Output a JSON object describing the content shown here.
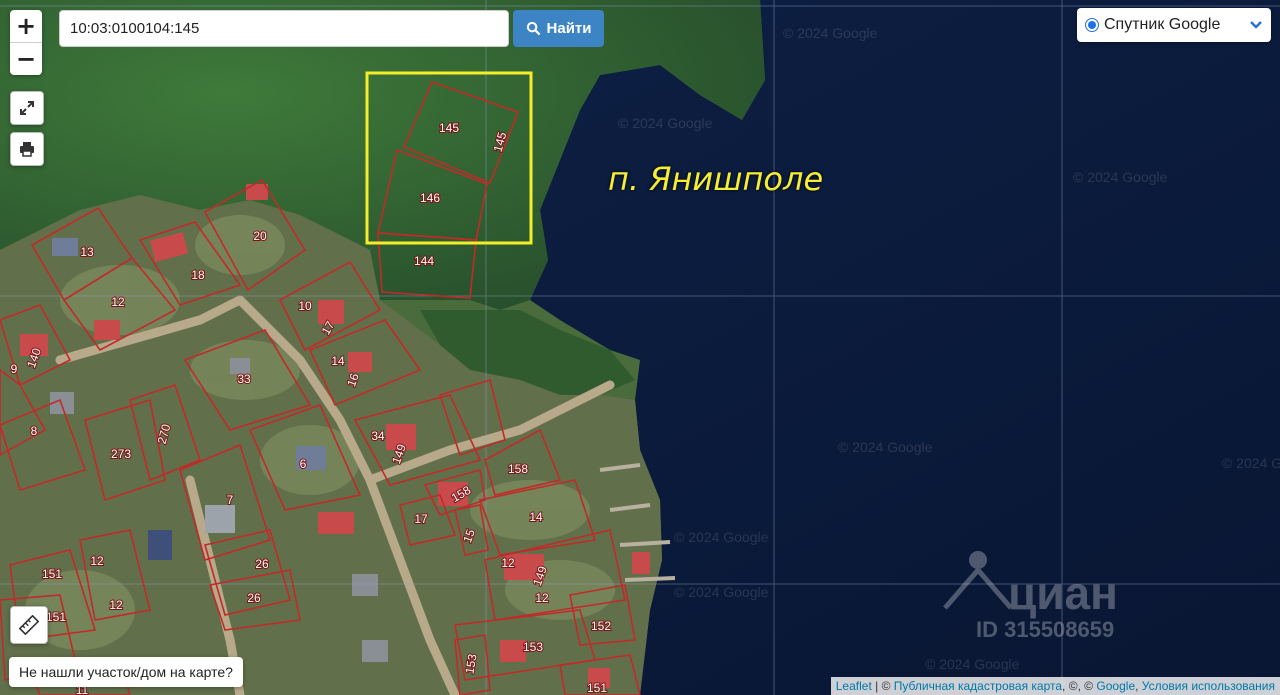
{
  "search": {
    "value": "10:03:0100104:145",
    "button_label": "Найти"
  },
  "zoom": {
    "in_label": "+",
    "out_label": "−"
  },
  "layer_select": {
    "selected": "Спутник Google"
  },
  "not_found_label": "Не нашли участок/дом на карте?",
  "place_label": "п. Янишполе",
  "attribution": {
    "leaflet": "Leaflet",
    "cadastral": "Публичная кадастровая карта",
    "copyright": "©",
    "google": "Google",
    "terms": "Условия использования"
  },
  "imagery_copyright": "© 2024 Google",
  "watermark": {
    "brand": "циан",
    "id": "ID 315508659"
  },
  "parcel_labels": {
    "p145a": "145",
    "p145b": "145",
    "p146": "146",
    "p144": "144",
    "p13": "13",
    "p20": "20",
    "p18": "18",
    "p12a": "12",
    "p10": "10",
    "p17a": "17",
    "p140": "140",
    "p9": "9",
    "p33": "33",
    "p14a": "14",
    "p16": "16",
    "p8": "8",
    "p270": "270",
    "p273": "273",
    "p34": "34",
    "p149a": "149",
    "p6": "6",
    "p158a": "158",
    "p158b": "158",
    "p7": "7",
    "p17b": "17",
    "p14b": "14",
    "p15": "15",
    "p151a": "151",
    "p12b": "12",
    "p26a": "26",
    "p12c": "12",
    "p149b": "149",
    "p12d": "12",
    "p151b": "151",
    "p26b": "26",
    "p152": "152",
    "p153a": "153",
    "p153b": "153",
    "p151c": "151",
    "p11": "11"
  },
  "colors": {
    "water": "#0b1a3a",
    "forest": "#2e5a2c",
    "parcel_line": "#c22a2a",
    "highlight": "#f4ee2a",
    "label_accent": "#f6ee34"
  },
  "icons": {
    "search": "search-icon",
    "expand": "expand-icon",
    "print": "printer-icon",
    "ruler": "ruler-icon",
    "chevron": "chevron-down-icon"
  }
}
